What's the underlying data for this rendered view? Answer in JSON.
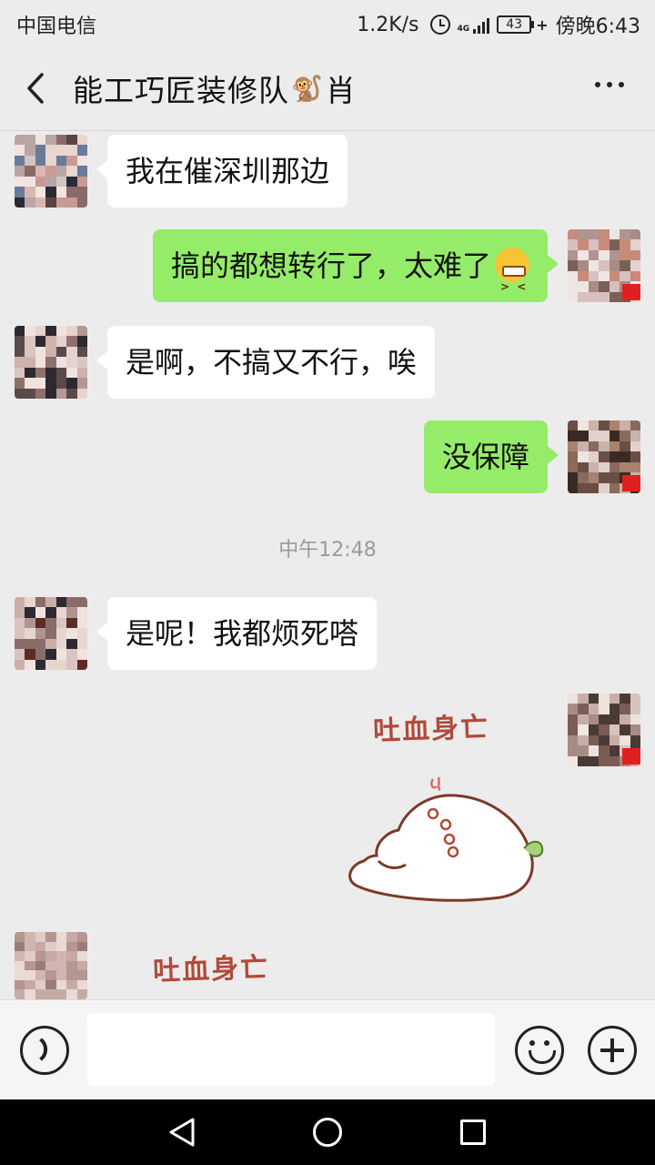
{
  "status_bar": {
    "carrier": "中国电信",
    "net_speed": "1.2K/s",
    "network_type": "4G",
    "battery": "43",
    "time": "傍晚6:43"
  },
  "header": {
    "title_prefix": "能工巧匠装修队",
    "title_emoji": "🐒",
    "title_suffix": "肖"
  },
  "messages": [
    {
      "side": "left",
      "text": "我在催深圳那边"
    },
    {
      "side": "right",
      "text": "搞的都想转行了，太难了"
    },
    {
      "side": "left",
      "text": "是啊，不搞又不行，唉"
    },
    {
      "side": "right",
      "text": "没保障"
    },
    {
      "side": "left",
      "text": "是呢！我都烦死嗒"
    }
  ],
  "time_divider": "中午12:48",
  "stickers": {
    "right_caption": "吐血身亡",
    "left_caption": "吐血身亡"
  },
  "input": {
    "placeholder": ""
  },
  "colors": {
    "sent_bubble": "#95ec69",
    "received_bubble": "#ffffff",
    "chat_background": "#ececec"
  }
}
